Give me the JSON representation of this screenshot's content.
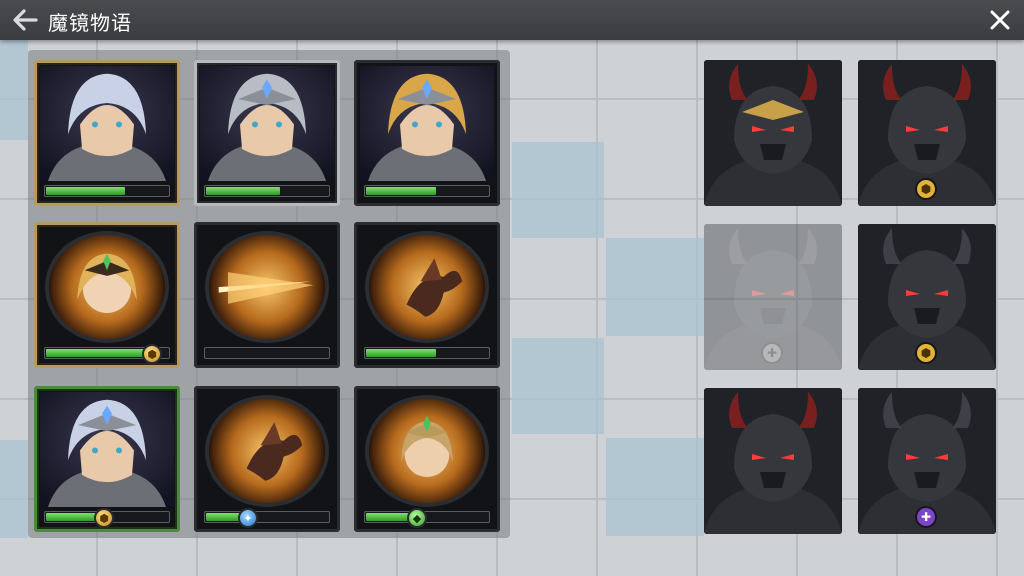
{
  "header": {
    "title": "魔镜物语",
    "back_icon": "arrow-left-icon",
    "close_icon": "close-icon"
  },
  "colors": {
    "topbar": "#3b3c3f",
    "hp_green": "#3bb33a",
    "frame_gold": "#b89b5c",
    "frame_green": "#4d8a3a"
  },
  "party": [
    {
      "name": "silver-haired-heroine",
      "frame": "gold",
      "kind": "portrait",
      "hp": 0.62,
      "badge": null
    },
    {
      "name": "silver-haired-knight",
      "frame": "silver",
      "kind": "portrait",
      "hp": 0.58,
      "badge": null
    },
    {
      "name": "blonde-knight",
      "frame": "dark",
      "kind": "portrait",
      "hp": 0.55,
      "badge": null
    },
    {
      "name": "blonde-princess-orb",
      "frame": "gold",
      "kind": "orb",
      "hp": 0.85,
      "badge": "gold"
    },
    {
      "name": "fire-slash-skill-orb",
      "frame": "dark",
      "kind": "orb",
      "hp": 0.0,
      "badge": null
    },
    {
      "name": "dragon-beast-orb",
      "frame": "dark",
      "kind": "orb",
      "hp": 0.55,
      "badge": null
    },
    {
      "name": "silver-haired-heroine-2",
      "frame": "green",
      "kind": "portrait",
      "hp": 0.48,
      "badge": "gold"
    },
    {
      "name": "dragon-beast-orb-2",
      "frame": "dark",
      "kind": "orb",
      "hp": 0.35,
      "badge": "blue"
    },
    {
      "name": "crowned-prince-orb",
      "frame": "dark",
      "kind": "orb",
      "hp": 0.42,
      "badge": "green"
    }
  ],
  "enemies": [
    {
      "name": "horned-gold-knight",
      "badge": null,
      "dim": false
    },
    {
      "name": "dark-armored-knight",
      "badge": "gold",
      "dim": false
    },
    {
      "name": "ghost-dark-knight",
      "badge": "grey",
      "dim": true
    },
    {
      "name": "horned-dark-knight",
      "badge": "gold",
      "dim": false
    },
    {
      "name": "red-horn-dark-knight",
      "badge": null,
      "dim": false
    },
    {
      "name": "dark-knight-purple",
      "badge": "purple",
      "dim": false
    }
  ]
}
